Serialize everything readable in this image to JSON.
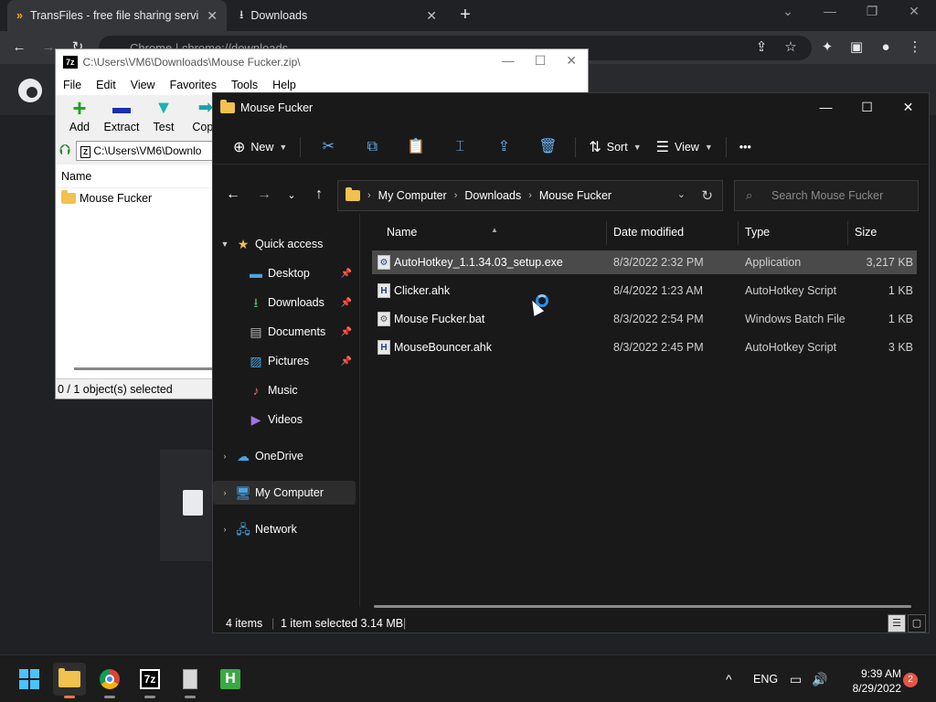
{
  "chrome": {
    "tabs": [
      {
        "label": "TransFiles - free file sharing servi",
        "close": "✕"
      },
      {
        "label": "Downloads",
        "close": "✕"
      }
    ],
    "new_tab": "+",
    "omnibox": "Chrome  |  chrome://downloads",
    "window_buttons": [
      "⌄",
      "—",
      "❐",
      "✕"
    ]
  },
  "sevenzip": {
    "title": "C:\\Users\\VM6\\Downloads\\Mouse Fucker.zip\\",
    "badge": "7z",
    "menu": [
      "File",
      "Edit",
      "View",
      "Favorites",
      "Tools",
      "Help"
    ],
    "tools": [
      {
        "label": "Add",
        "glyph": "+",
        "color": "#1aa31a"
      },
      {
        "label": "Extract",
        "glyph": "▬",
        "color": "#1a2fb0"
      },
      {
        "label": "Test",
        "glyph": "▼",
        "color": "#17b3b3"
      },
      {
        "label": "Copy",
        "glyph": "➡",
        "color": "#17a3a3"
      }
    ],
    "path": "C:\\Users\\VM6\\Downlo",
    "column_name": "Name",
    "items": [
      "Mouse Fucker"
    ],
    "status": "0 / 1 object(s) selected",
    "window_buttons": [
      "—",
      "☐",
      "✕"
    ]
  },
  "explorer": {
    "title": "Mouse Fucker",
    "window_buttons": [
      "—",
      "☐",
      "✕"
    ],
    "commands": {
      "new": "New",
      "sort": "Sort",
      "view": "View",
      "more": "•••"
    },
    "breadcrumb": [
      "My Computer",
      "Downloads",
      "Mouse Fucker"
    ],
    "search_placeholder": "Search Mouse Fucker",
    "nav": {
      "quick_access": "Quick access",
      "items": [
        {
          "label": "Desktop",
          "icon": "desktop-icon",
          "pinned": true
        },
        {
          "label": "Downloads",
          "icon": "downloads-icon",
          "pinned": true
        },
        {
          "label": "Documents",
          "icon": "documents-icon",
          "pinned": true
        },
        {
          "label": "Pictures",
          "icon": "pictures-icon",
          "pinned": true
        },
        {
          "label": "Music",
          "icon": "music-icon",
          "pinned": false
        },
        {
          "label": "Videos",
          "icon": "videos-icon",
          "pinned": false
        }
      ],
      "onedrive": "OneDrive",
      "my_computer": "My Computer",
      "network": "Network"
    },
    "columns": {
      "name": "Name",
      "date": "Date modified",
      "type": "Type",
      "size": "Size"
    },
    "files": [
      {
        "name": "AutoHotkey_1.1.34.03_setup.exe",
        "date": "8/3/2022 2:32 PM",
        "type": "Application",
        "size": "3,217 KB",
        "icon": "exe-icon",
        "selected": true
      },
      {
        "name": "Clicker.ahk",
        "date": "8/4/2022 1:23 AM",
        "type": "AutoHotkey Script",
        "size": "1 KB",
        "icon": "ahk-icon",
        "selected": false
      },
      {
        "name": "Mouse Fucker.bat",
        "date": "8/3/2022 2:54 PM",
        "type": "Windows Batch File",
        "size": "1 KB",
        "icon": "bat-icon",
        "selected": false
      },
      {
        "name": "MouseBouncer.ahk",
        "date": "8/3/2022 2:45 PM",
        "type": "AutoHotkey Script",
        "size": "3 KB",
        "icon": "ahk-icon",
        "selected": false
      }
    ],
    "status": {
      "count": "4 items",
      "selection": "1 item selected  3.14 MB"
    }
  },
  "taskbar": {
    "apps": [
      "start-icon",
      "file-explorer-icon",
      "chrome-icon",
      "7zip-icon",
      "notepad-icon",
      "autohotkey-icon"
    ],
    "seven_zip_label": "7z",
    "ahk_label": "H",
    "tray_chevron": "^",
    "language": "ENG",
    "time": "9:39 AM",
    "date": "8/29/2022",
    "notifications": "2"
  },
  "colors": {
    "accent": "#4cc2ff",
    "selected_row": "#4a4a4a",
    "busy_cursor": "#2b8ef0"
  }
}
